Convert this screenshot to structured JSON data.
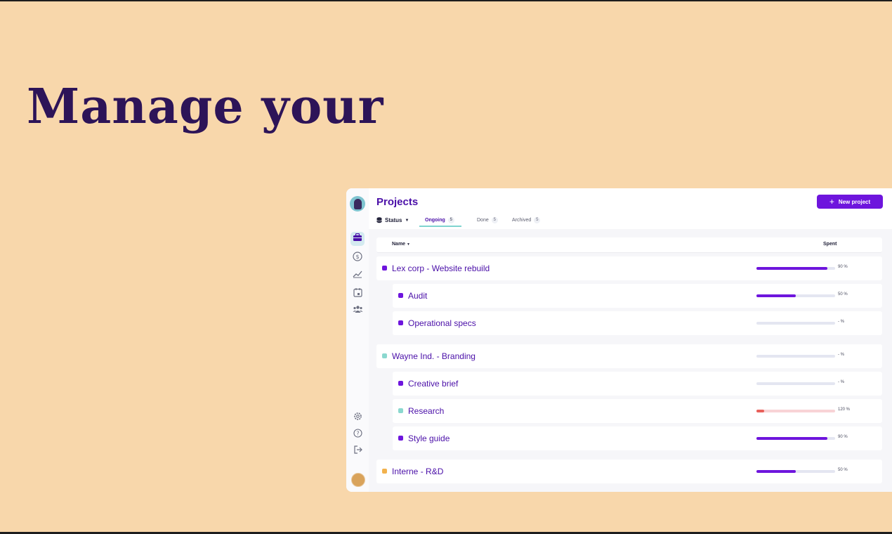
{
  "hero": {
    "headline": "Manage your"
  },
  "app": {
    "page_title": "Projects",
    "new_project_label": "New project",
    "status_filter_label": "Status",
    "tabs": [
      {
        "label": "Ongoing",
        "count": "5"
      },
      {
        "label": "Done",
        "count": "5"
      },
      {
        "label": "Archived",
        "count": "5"
      }
    ],
    "columns": {
      "name": "Name",
      "spent": "Spent"
    },
    "rows": [
      {
        "name": "Lex corp - Website rebuild",
        "level": 0,
        "color": "#6e15dd",
        "spent_text": "90 %",
        "spent_pct": 90
      },
      {
        "name": "Audit",
        "level": 1,
        "color": "#6e15dd",
        "spent_text": "50 %",
        "spent_pct": 50
      },
      {
        "name": "Operational specs",
        "level": 1,
        "color": "#6e15dd",
        "spent_text": "- %",
        "spent_pct": null
      },
      {
        "name": "Wayne Ind. - Branding",
        "level": 0,
        "color": "#8bd8cf",
        "spent_text": "- %",
        "spent_pct": null
      },
      {
        "name": "Creative brief",
        "level": 1,
        "color": "#6e15dd",
        "spent_text": "- %",
        "spent_pct": null
      },
      {
        "name": "Research",
        "level": 1,
        "color": "#8bd8cf",
        "spent_text": "120 %",
        "spent_pct": 120
      },
      {
        "name": "Style guide",
        "level": 1,
        "color": "#6e15dd",
        "spent_text": "90 %",
        "spent_pct": 90
      },
      {
        "name": "Interne - R&D",
        "level": 0,
        "color": "#f2b24d",
        "spent_text": "50 %",
        "spent_pct": 50
      }
    ],
    "sidebar_icons": [
      "projects-icon",
      "billing-icon",
      "reports-icon",
      "calendar-icon",
      "team-icon",
      "settings-icon",
      "help-icon",
      "logout-icon"
    ]
  },
  "colors": {
    "page_background": "#f8d7ab",
    "headline": "#2d1458",
    "accent": "#6e15dd",
    "over_budget_fill": "#e8605a",
    "over_budget_track": "#f8d3d6"
  }
}
